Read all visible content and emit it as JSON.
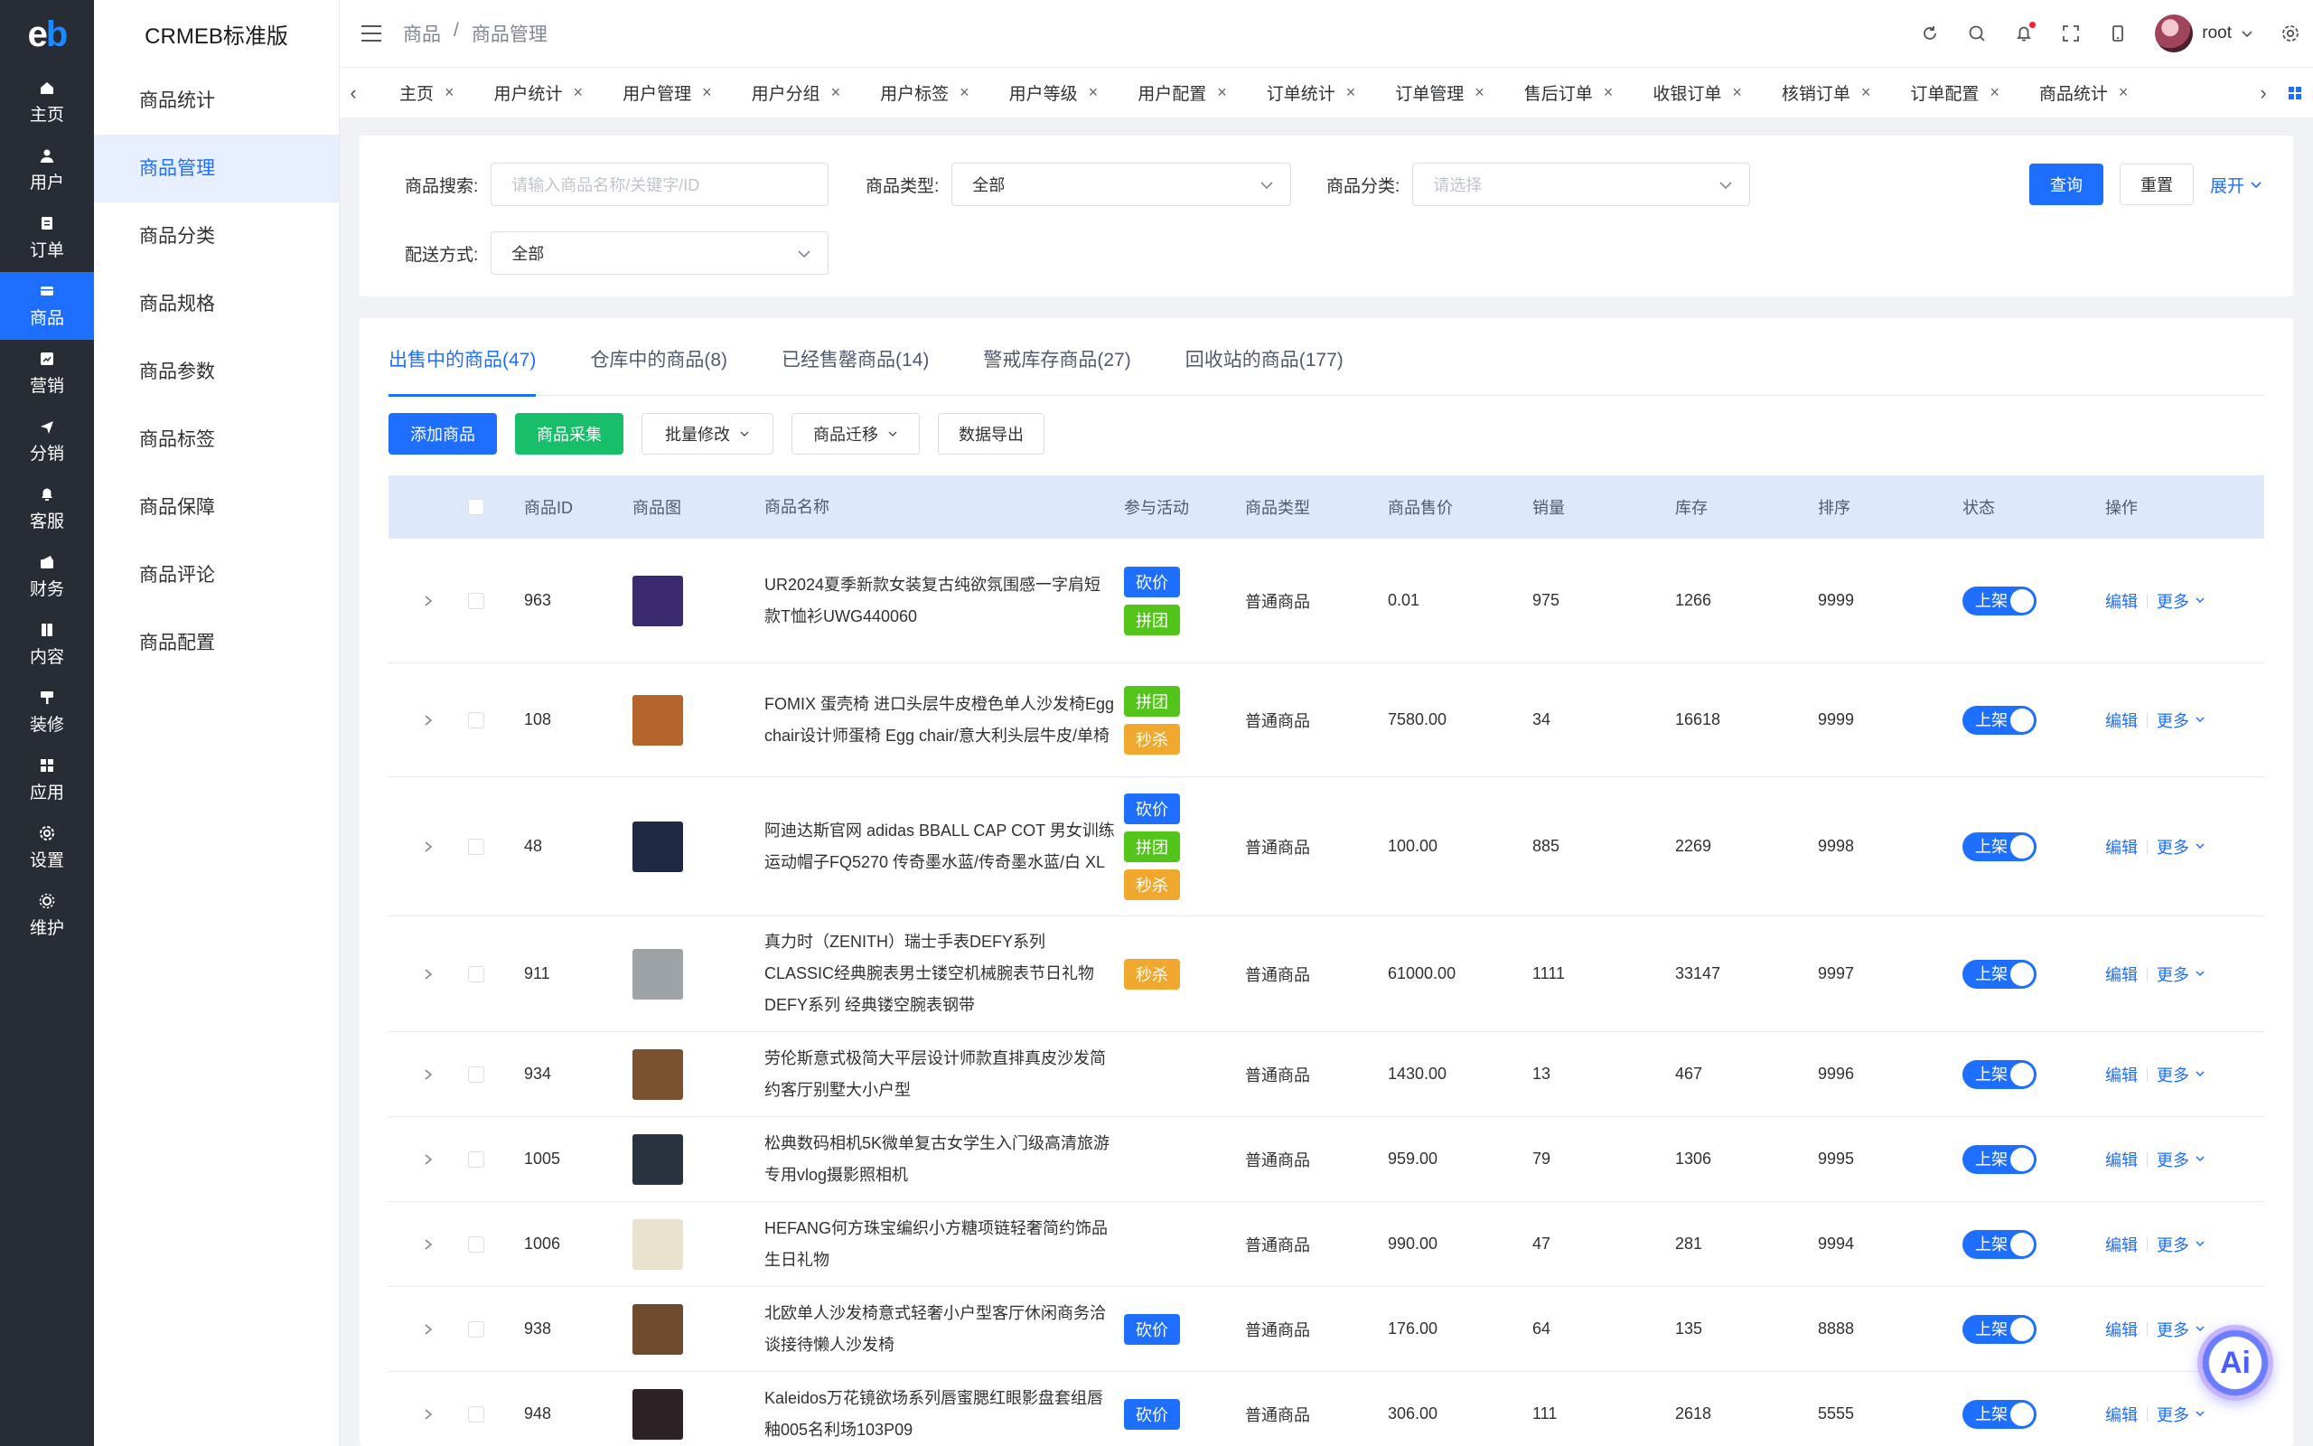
{
  "logo": {
    "text_e": "e",
    "text_b": "b"
  },
  "dark_nav": [
    {
      "label": "主页",
      "icon": "home-icon"
    },
    {
      "label": "用户",
      "icon": "user-icon"
    },
    {
      "label": "订单",
      "icon": "order-icon"
    },
    {
      "label": "商品",
      "icon": "product-icon",
      "active": true
    },
    {
      "label": "营销",
      "icon": "marketing-icon"
    },
    {
      "label": "分销",
      "icon": "distribution-icon"
    },
    {
      "label": "客服",
      "icon": "service-icon"
    },
    {
      "label": "财务",
      "icon": "finance-icon"
    },
    {
      "label": "内容",
      "icon": "content-icon"
    },
    {
      "label": "装修",
      "icon": "decoration-icon"
    },
    {
      "label": "应用",
      "icon": "apps-icon"
    },
    {
      "label": "设置",
      "icon": "settings-icon"
    },
    {
      "label": "维护",
      "icon": "maintenance-icon"
    }
  ],
  "sub_menu": {
    "brand": "CRMEB标准版",
    "items": [
      "商品统计",
      "商品管理",
      "商品分类",
      "商品规格",
      "商品参数",
      "商品标签",
      "商品保障",
      "商品评论",
      "商品配置"
    ],
    "active_index": 1
  },
  "header": {
    "breadcrumb": [
      "商品",
      "/",
      "商品管理"
    ],
    "username": "root"
  },
  "tabs": [
    "主页",
    "用户统计",
    "用户管理",
    "用户分组",
    "用户标签",
    "用户等级",
    "用户配置",
    "订单统计",
    "订单管理",
    "售后订单",
    "收银订单",
    "核销订单",
    "订单配置",
    "商品统计"
  ],
  "search": {
    "keyword_label": "商品搜索:",
    "keyword_placeholder": "请输入商品名称/关键字/ID",
    "type_label": "商品类型:",
    "type_value": "全部",
    "category_label": "商品分类:",
    "category_placeholder": "请选择",
    "delivery_label": "配送方式:",
    "delivery_value": "全部",
    "query_btn": "查询",
    "reset_btn": "重置",
    "expand_btn": "展开"
  },
  "status_tabs": [
    "出售中的商品(47)",
    "仓库中的商品(8)",
    "已经售罄商品(14)",
    "警戒库存商品(27)",
    "回收站的商品(177)"
  ],
  "actions": {
    "add": "添加商品",
    "collect": "商品采集",
    "batch": "批量修改",
    "migrate": "商品迁移",
    "export": "数据导出"
  },
  "table": {
    "headers": [
      "商品ID",
      "商品图",
      "商品名称",
      "参与活动",
      "商品类型",
      "商品售价",
      "销量",
      "库存",
      "排序",
      "状态",
      "操作"
    ],
    "status_on": "上架",
    "edit": "编辑",
    "more": "更多",
    "rows": [
      {
        "id": "963",
        "name": "UR2024夏季新款女装复古纯欲氛围感一字肩短款T恤衫UWG440060",
        "tags": [
          "砍价",
          "拼团"
        ],
        "type": "普通商品",
        "price": "0.01",
        "sales": "975",
        "stock": "1266",
        "sort": "9999",
        "thumb": "#3b2a6e",
        "h": 138
      },
      {
        "id": "108",
        "name": "FOMIX 蛋壳椅 进口头层牛皮橙色单人沙发椅Egg chair设计师蛋椅 Egg chair/意大利头层牛皮/单椅",
        "tags": [
          "拼团",
          "秒杀"
        ],
        "type": "普通商品",
        "price": "7580.00",
        "sales": "34",
        "stock": "16618",
        "sort": "9999",
        "thumb": "#b5642c",
        "h": 126
      },
      {
        "id": "48",
        "name": "阿迪达斯官网 adidas BBALL CAP COT 男女训练运动帽子FQ5270 传奇墨水蓝/传奇墨水蓝/白 XL",
        "tags": [
          "砍价",
          "拼团",
          "秒杀"
        ],
        "type": "普通商品",
        "price": "100.00",
        "sales": "885",
        "stock": "2269",
        "sort": "9998",
        "thumb": "#1e2a44",
        "h": 154
      },
      {
        "id": "911",
        "name": "真力时（ZENITH）瑞士手表DEFY系列CLASSIC经典腕表男士镂空机械腕表节日礼物 DEFY系列 经典镂空腕表钢带",
        "tags": [
          "秒杀"
        ],
        "type": "普通商品",
        "price": "61000.00",
        "sales": "1111",
        "stock": "33147",
        "sort": "9997",
        "thumb": "#9ea3a8",
        "h": 128
      },
      {
        "id": "934",
        "name": "劳伦斯意式极简大平层设计师款直排真皮沙发简约客厅别墅大小户型",
        "tags": [],
        "type": "普通商品",
        "price": "1430.00",
        "sales": "13",
        "stock": "467",
        "sort": "9996",
        "thumb": "#7a5230",
        "h": 94
      },
      {
        "id": "1005",
        "name": "松典数码相机5K微单复古女学生入门级高清旅游专用vlog摄影照相机",
        "tags": [],
        "type": "普通商品",
        "price": "959.00",
        "sales": "79",
        "stock": "1306",
        "sort": "9995",
        "thumb": "#2a3440",
        "h": 94
      },
      {
        "id": "1006",
        "name": "HEFANG何方珠宝编织小方糖项链轻奢简约饰品生日礼物",
        "tags": [],
        "type": "普通商品",
        "price": "990.00",
        "sales": "47",
        "stock": "281",
        "sort": "9994",
        "thumb": "#e9e2cf",
        "h": 94
      },
      {
        "id": "938",
        "name": "北欧单人沙发椅意式轻奢小户型客厅休闲商务洽谈接待懒人沙发椅",
        "tags": [
          "砍价"
        ],
        "type": "普通商品",
        "price": "176.00",
        "sales": "64",
        "stock": "135",
        "sort": "8888",
        "thumb": "#6e4a2e",
        "h": 94
      },
      {
        "id": "948",
        "name": "Kaleidos万花镜欲场系列唇蜜腮红眼影盘套组唇釉005名利场103P09",
        "tags": [
          "砍价"
        ],
        "type": "普通商品",
        "price": "306.00",
        "sales": "111",
        "stock": "2618",
        "sort": "5555",
        "thumb": "#2c2226",
        "h": 94
      }
    ]
  },
  "ai_bubble": "Ai",
  "colors": {
    "primary": "#1e6fff",
    "success": "#19be6b",
    "tag_bargain": "#1e6fff",
    "tag_group": "#52c41a",
    "tag_seckill": "#f0a92e",
    "nav_bg": "#282c34"
  }
}
